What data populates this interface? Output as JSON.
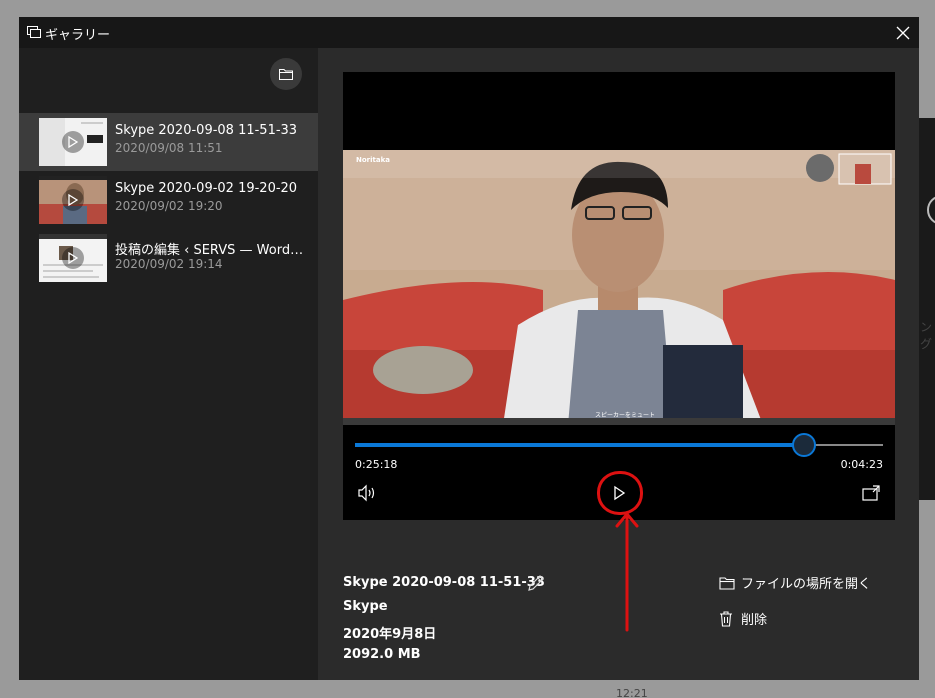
{
  "window": {
    "title": "ギャラリー",
    "close_icon": "close-icon"
  },
  "sidebar": {
    "folder_icon": "folder-icon",
    "items": [
      {
        "title": "Skype 2020-09-08 11-51-33",
        "date": "2020/09/08 11:51",
        "selected": true
      },
      {
        "title": "Skype 2020-09-02 19-20-20",
        "date": "2020/09/02 19:20",
        "selected": false
      },
      {
        "title": "投稿の編集 ‹ SERVS — WordPress",
        "date": "2020/09/02 19:14",
        "selected": false
      }
    ]
  },
  "video": {
    "call_name": "Noritaka",
    "caption": "スピーカーをミュート",
    "time_current": "0:25:18",
    "time_remaining": "0:04:23",
    "progress_fraction": 0.85
  },
  "info": {
    "title": "Skype 2020-09-08 11-51-33",
    "app": "Skype",
    "date": "2020年9月8日",
    "size": "2092.0 MB",
    "open_location": "ファイルの場所を開く",
    "delete": "削除"
  },
  "desktop": {
    "clock": "12:21",
    "right_text": "ング"
  },
  "colors": {
    "accent": "#0a78d7",
    "annotation": "#d11111"
  }
}
